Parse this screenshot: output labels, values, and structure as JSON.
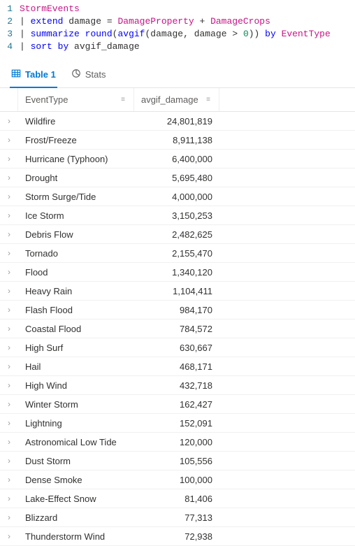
{
  "editor": {
    "lines": [
      {
        "n": "1",
        "tokens": [
          {
            "t": "StormEvents",
            "c": "tok-col"
          }
        ]
      },
      {
        "n": "2",
        "tokens": [
          {
            "t": "| ",
            "c": "tok-pipe"
          },
          {
            "t": "extend",
            "c": "tok-keyword"
          },
          {
            "t": " damage ",
            "c": "tok-ident"
          },
          {
            "t": "= ",
            "c": "tok-op"
          },
          {
            "t": "DamageProperty",
            "c": "tok-col"
          },
          {
            "t": " + ",
            "c": "tok-op"
          },
          {
            "t": "DamageCrops",
            "c": "tok-col"
          }
        ]
      },
      {
        "n": "3",
        "tokens": [
          {
            "t": "| ",
            "c": "tok-pipe"
          },
          {
            "t": "summarize",
            "c": "tok-keyword"
          },
          {
            "t": " ",
            "c": "tok-ident"
          },
          {
            "t": "round",
            "c": "tok-func"
          },
          {
            "t": "(",
            "c": "tok-op"
          },
          {
            "t": "avgif",
            "c": "tok-func"
          },
          {
            "t": "(damage, damage ",
            "c": "tok-ident"
          },
          {
            "t": ">",
            "c": "tok-op"
          },
          {
            "t": " ",
            "c": "tok-ident"
          },
          {
            "t": "0",
            "c": "tok-num"
          },
          {
            "t": ")) ",
            "c": "tok-op"
          },
          {
            "t": "by",
            "c": "tok-by"
          },
          {
            "t": " ",
            "c": "tok-ident"
          },
          {
            "t": "EventType",
            "c": "tok-col"
          }
        ]
      },
      {
        "n": "4",
        "tokens": [
          {
            "t": "| ",
            "c": "tok-pipe"
          },
          {
            "t": "sort",
            "c": "tok-keyword"
          },
          {
            "t": " ",
            "c": "tok-ident"
          },
          {
            "t": "by",
            "c": "tok-by"
          },
          {
            "t": " avgif_damage",
            "c": "tok-ident"
          }
        ]
      }
    ]
  },
  "tabs": {
    "table_label": "Table 1",
    "stats_label": "Stats"
  },
  "columns": {
    "c1": "EventType",
    "c2": "avgif_damage"
  },
  "rows": [
    {
      "event": "Wildfire",
      "dmg": "24,801,819"
    },
    {
      "event": "Frost/Freeze",
      "dmg": "8,911,138"
    },
    {
      "event": "Hurricane (Typhoon)",
      "dmg": "6,400,000"
    },
    {
      "event": "Drought",
      "dmg": "5,695,480"
    },
    {
      "event": "Storm Surge/Tide",
      "dmg": "4,000,000"
    },
    {
      "event": "Ice Storm",
      "dmg": "3,150,253"
    },
    {
      "event": "Debris Flow",
      "dmg": "2,482,625"
    },
    {
      "event": "Tornado",
      "dmg": "2,155,470"
    },
    {
      "event": "Flood",
      "dmg": "1,340,120"
    },
    {
      "event": "Heavy Rain",
      "dmg": "1,104,411"
    },
    {
      "event": "Flash Flood",
      "dmg": "984,170"
    },
    {
      "event": "Coastal Flood",
      "dmg": "784,572"
    },
    {
      "event": "High Surf",
      "dmg": "630,667"
    },
    {
      "event": "Hail",
      "dmg": "468,171"
    },
    {
      "event": "High Wind",
      "dmg": "432,718"
    },
    {
      "event": "Winter Storm",
      "dmg": "162,427"
    },
    {
      "event": "Lightning",
      "dmg": "152,091"
    },
    {
      "event": "Astronomical Low Tide",
      "dmg": "120,000"
    },
    {
      "event": "Dust Storm",
      "dmg": "105,556"
    },
    {
      "event": "Dense Smoke",
      "dmg": "100,000"
    },
    {
      "event": "Lake-Effect Snow",
      "dmg": "81,406"
    },
    {
      "event": "Blizzard",
      "dmg": "77,313"
    },
    {
      "event": "Thunderstorm Wind",
      "dmg": "72,938"
    }
  ]
}
